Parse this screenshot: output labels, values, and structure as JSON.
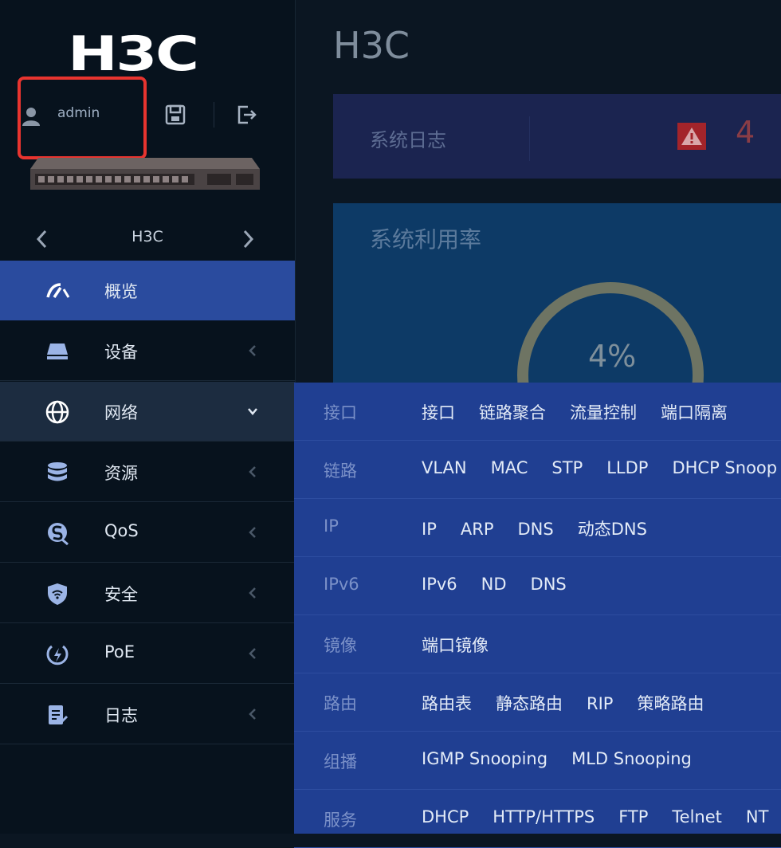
{
  "brand": {
    "logo_text": "H3C"
  },
  "user": {
    "name": "admin"
  },
  "device": {
    "name": "H3C"
  },
  "nav": {
    "items": [
      {
        "label": "概览",
        "icon": "dashboard-icon",
        "state": "active"
      },
      {
        "label": "设备",
        "icon": "device-icon",
        "state": "collapsed"
      },
      {
        "label": "网络",
        "icon": "network-icon",
        "state": "expanded"
      },
      {
        "label": "资源",
        "icon": "resource-icon",
        "state": "collapsed"
      },
      {
        "label": "QoS",
        "icon": "qos-icon",
        "state": "collapsed"
      },
      {
        "label": "安全",
        "icon": "security-icon",
        "state": "collapsed"
      },
      {
        "label": "PoE",
        "icon": "poe-icon",
        "state": "collapsed"
      },
      {
        "label": "日志",
        "icon": "log-icon",
        "state": "collapsed"
      }
    ]
  },
  "main": {
    "title": "H3C",
    "syslog": {
      "label": "系统日志",
      "count": "4"
    },
    "utilization": {
      "title": "系统利用率",
      "value": "4%",
      "fraction": 0.04
    }
  },
  "network_menu": {
    "rows": [
      {
        "category": "接口",
        "links": [
          "接口",
          "链路聚合",
          "流量控制",
          "端口隔离"
        ]
      },
      {
        "category": "链路",
        "links": [
          "VLAN",
          "MAC",
          "STP",
          "LLDP",
          "DHCP Snoop"
        ]
      },
      {
        "category": "IP",
        "links": [
          "IP",
          "ARP",
          "DNS",
          "动态DNS"
        ]
      },
      {
        "category": "IPv6",
        "links": [
          "IPv6",
          "ND",
          "DNS"
        ]
      },
      {
        "category": "镜像",
        "links": [
          "端口镜像"
        ]
      },
      {
        "category": "路由",
        "links": [
          "路由表",
          "静态路由",
          "RIP",
          "策略路由"
        ]
      },
      {
        "category": "组播",
        "links": [
          "IGMP Snooping",
          "MLD Snooping"
        ]
      },
      {
        "category": "服务",
        "links": [
          "DHCP",
          "HTTP/HTTPS",
          "FTP",
          "Telnet",
          "NT"
        ]
      }
    ]
  },
  "colors": {
    "accent": "#2a4b9e",
    "menu_bg": "#203f92",
    "highlight_box": "#e8342f",
    "alert": "#c0282d"
  }
}
